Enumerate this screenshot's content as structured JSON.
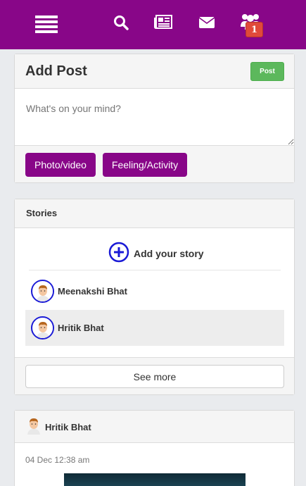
{
  "topbar": {
    "notification_count": "1",
    "background": "#880688"
  },
  "add_post": {
    "title": "Add Post",
    "post_button": "Post",
    "placeholder": "What's on your mind?",
    "photo_button": "Photo/video",
    "feeling_button": "Feeling/Activity"
  },
  "stories": {
    "title": "Stories",
    "add_story": "Add your story",
    "items": [
      {
        "name": "Meenakshi Bhat"
      },
      {
        "name": "Hritik Bhat"
      }
    ],
    "see_more": "See more"
  },
  "post": {
    "author": "Hritik Bhat",
    "time": "04 Dec 12:38 am"
  },
  "colors": {
    "brand": "#880688",
    "post_button": "#5cb85c",
    "badge": "#e04a3a",
    "ring": "#1a1ad6"
  }
}
